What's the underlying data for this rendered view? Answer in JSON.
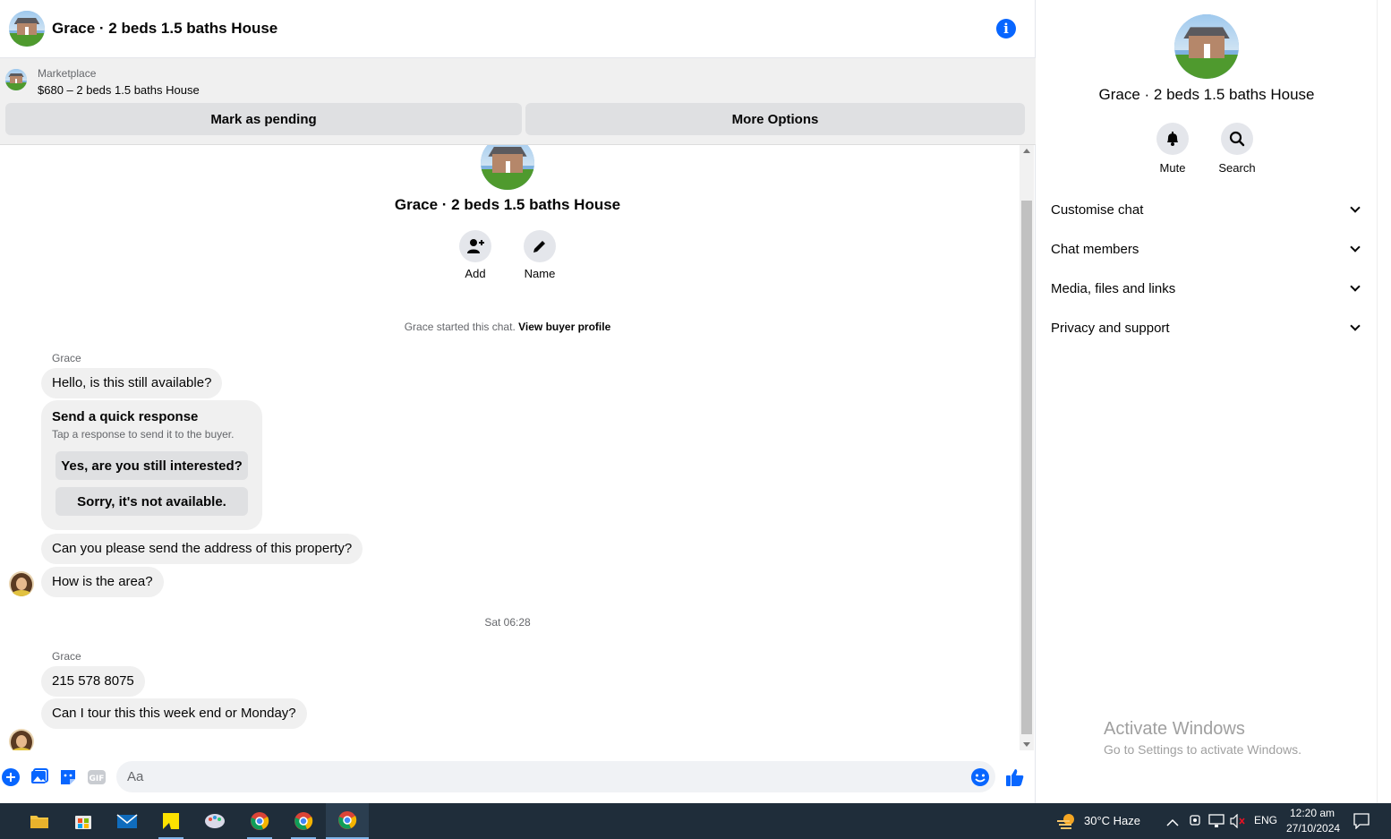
{
  "header": {
    "title": "Grace · 2 beds 1.5 baths House"
  },
  "marketplace": {
    "label": "Marketplace",
    "listing": "$680 – 2 beds 1.5 baths House",
    "mark_pending": "Mark as pending",
    "more_options": "More Options"
  },
  "thread": {
    "title": "Grace · 2 beds 1.5 baths House",
    "add_label": "Add",
    "name_label": "Name",
    "system_text": "Grace started this chat.",
    "system_link": "View buyer profile",
    "sender1": "Grace",
    "messages1": [
      "Hello, is this still available?"
    ],
    "quick_response": {
      "title": "Send a quick response",
      "subtitle": "Tap a response to send it to the buyer.",
      "options": [
        "Yes, are you still interested?",
        "Sorry, it's not available."
      ]
    },
    "messages2": [
      "Can you please send the address of this property?",
      "How is the area?"
    ],
    "timestamp": "Sat 06:28",
    "sender2": "Grace",
    "messages3": [
      "215 578 8075",
      "Can I tour this this week end or Monday?"
    ]
  },
  "composer": {
    "placeholder": "Aa"
  },
  "info_panel": {
    "title": "Grace · 2 beds 1.5 baths House",
    "mute_label": "Mute",
    "search_label": "Search",
    "sections": [
      "Customise chat",
      "Chat members",
      "Media, files and links",
      "Privacy and support"
    ]
  },
  "watermark": {
    "line1": "Activate Windows",
    "line2": "Go to Settings to activate Windows."
  },
  "taskbar": {
    "weather": "30°C  Haze",
    "language": "ENG",
    "time": "12:20 am",
    "date": "27/10/2024"
  },
  "colors": {
    "accent": "#0866ff",
    "bubble": "#f0f0f0",
    "taskbar": "#1f2d3a"
  }
}
